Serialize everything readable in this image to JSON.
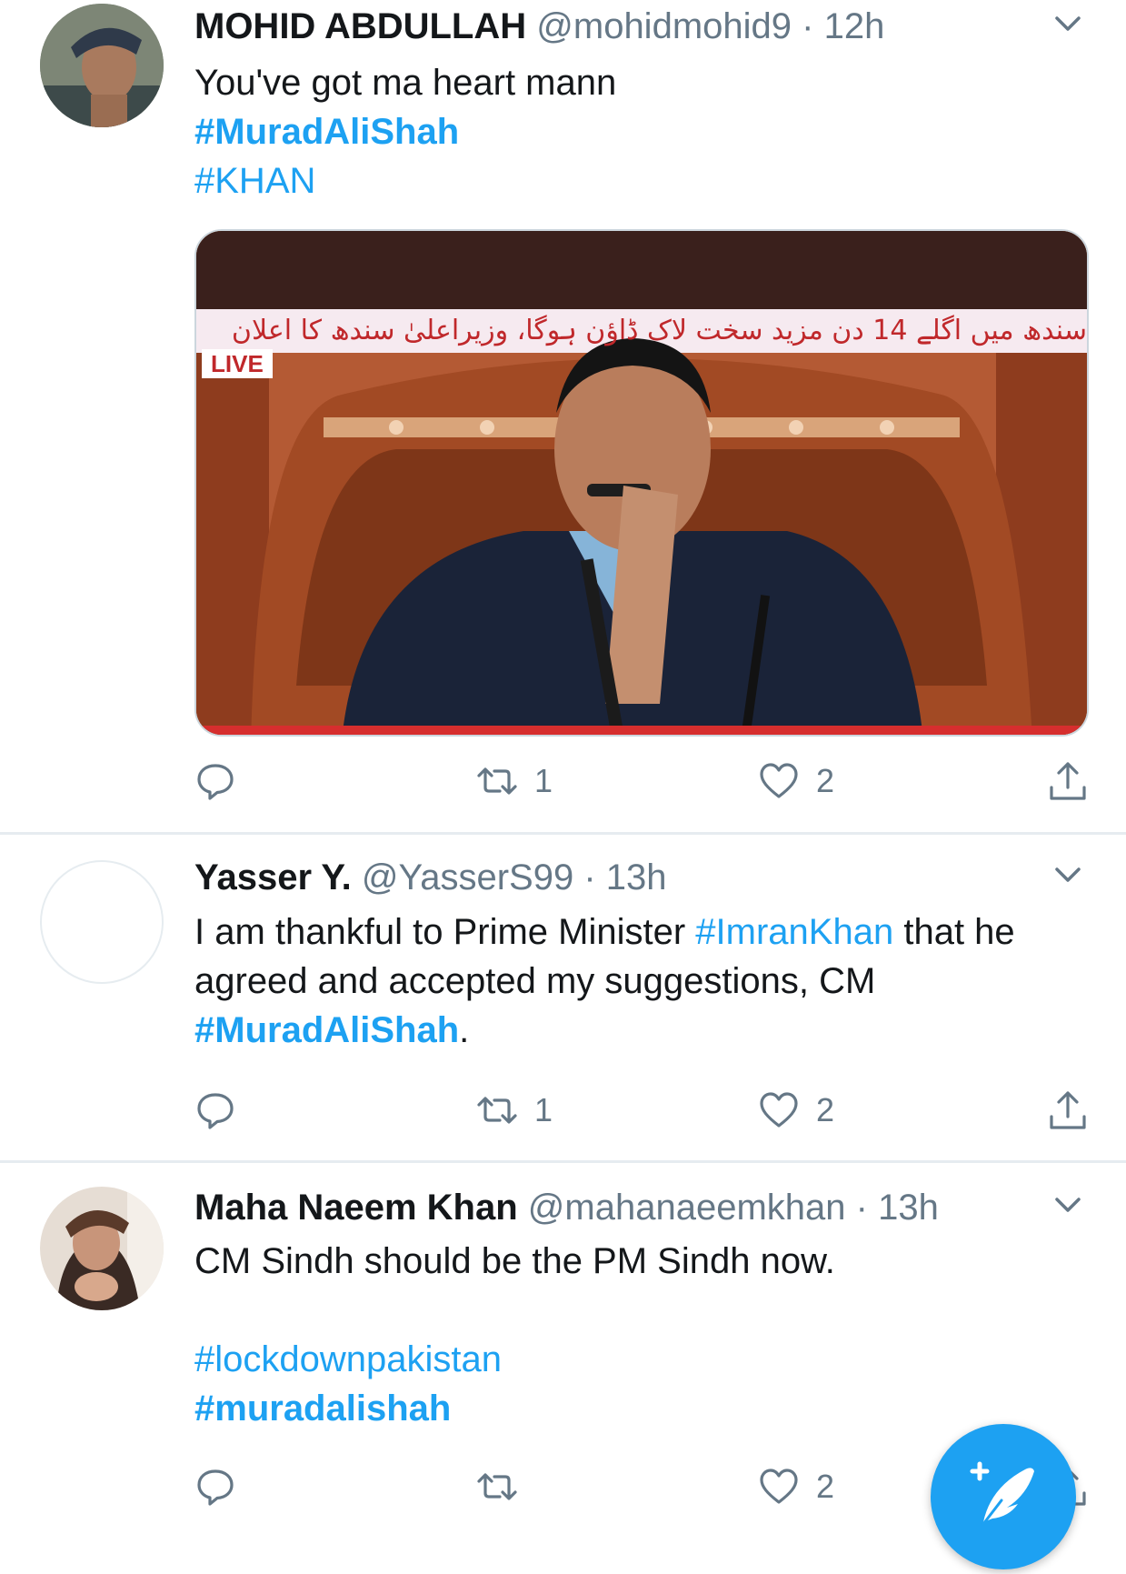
{
  "tweets": [
    {
      "name": "MOHID ABDULLAH",
      "handle": "@mohidmohid9",
      "time": "12h",
      "body": [
        {
          "type": "text",
          "value": "You've got ma heart mann"
        },
        {
          "type": "tag",
          "value": "#MuradAliShah"
        },
        {
          "type": "tag",
          "value": "#KHAN"
        }
      ],
      "media": {
        "ticker": "سندھ میں اگلے 14 دن مزید سخت لاک ڈاؤن ہوگا، وزیراعلیٰ سندھ کا اعلان",
        "live_label": "LIVE"
      },
      "actions": {
        "reply": "",
        "retweet": "1",
        "like": "2"
      }
    },
    {
      "name": "Yasser Y.",
      "handle": "@YasserS99",
      "time": "13h",
      "body": [
        {
          "type": "text",
          "value": "I am thankful to Prime Minister "
        },
        {
          "type": "tag",
          "value": "#ImranKhan"
        },
        {
          "type": "text",
          "value": " that he agreed and accepted my suggestions, CM "
        },
        {
          "type": "tag",
          "value": "#MuradAliShah"
        },
        {
          "type": "text",
          "value": "."
        }
      ],
      "actions": {
        "reply": "",
        "retweet": "1",
        "like": "2"
      }
    },
    {
      "name": "Maha Naeem Khan",
      "handle": "@mahanaeemkhan",
      "time": "13h",
      "body": [
        {
          "type": "text",
          "value": "CM Sindh should be the PM Sindh now."
        },
        {
          "type": "tag",
          "value": "#lockdownpakistan"
        },
        {
          "type": "tag",
          "value": "#muradalishah"
        }
      ],
      "actions": {
        "reply": "",
        "retweet": "",
        "like": "2"
      }
    }
  ],
  "separator": "·",
  "colors": {
    "accent": "#1da1f2",
    "muted": "#657786",
    "text": "#14171a",
    "divider": "#e6ecf0"
  },
  "icons": {
    "reply": "reply-icon",
    "retweet": "retweet-icon",
    "like": "heart-icon",
    "share": "share-icon",
    "menu": "chevron-down-icon",
    "compose": "compose-icon"
  }
}
